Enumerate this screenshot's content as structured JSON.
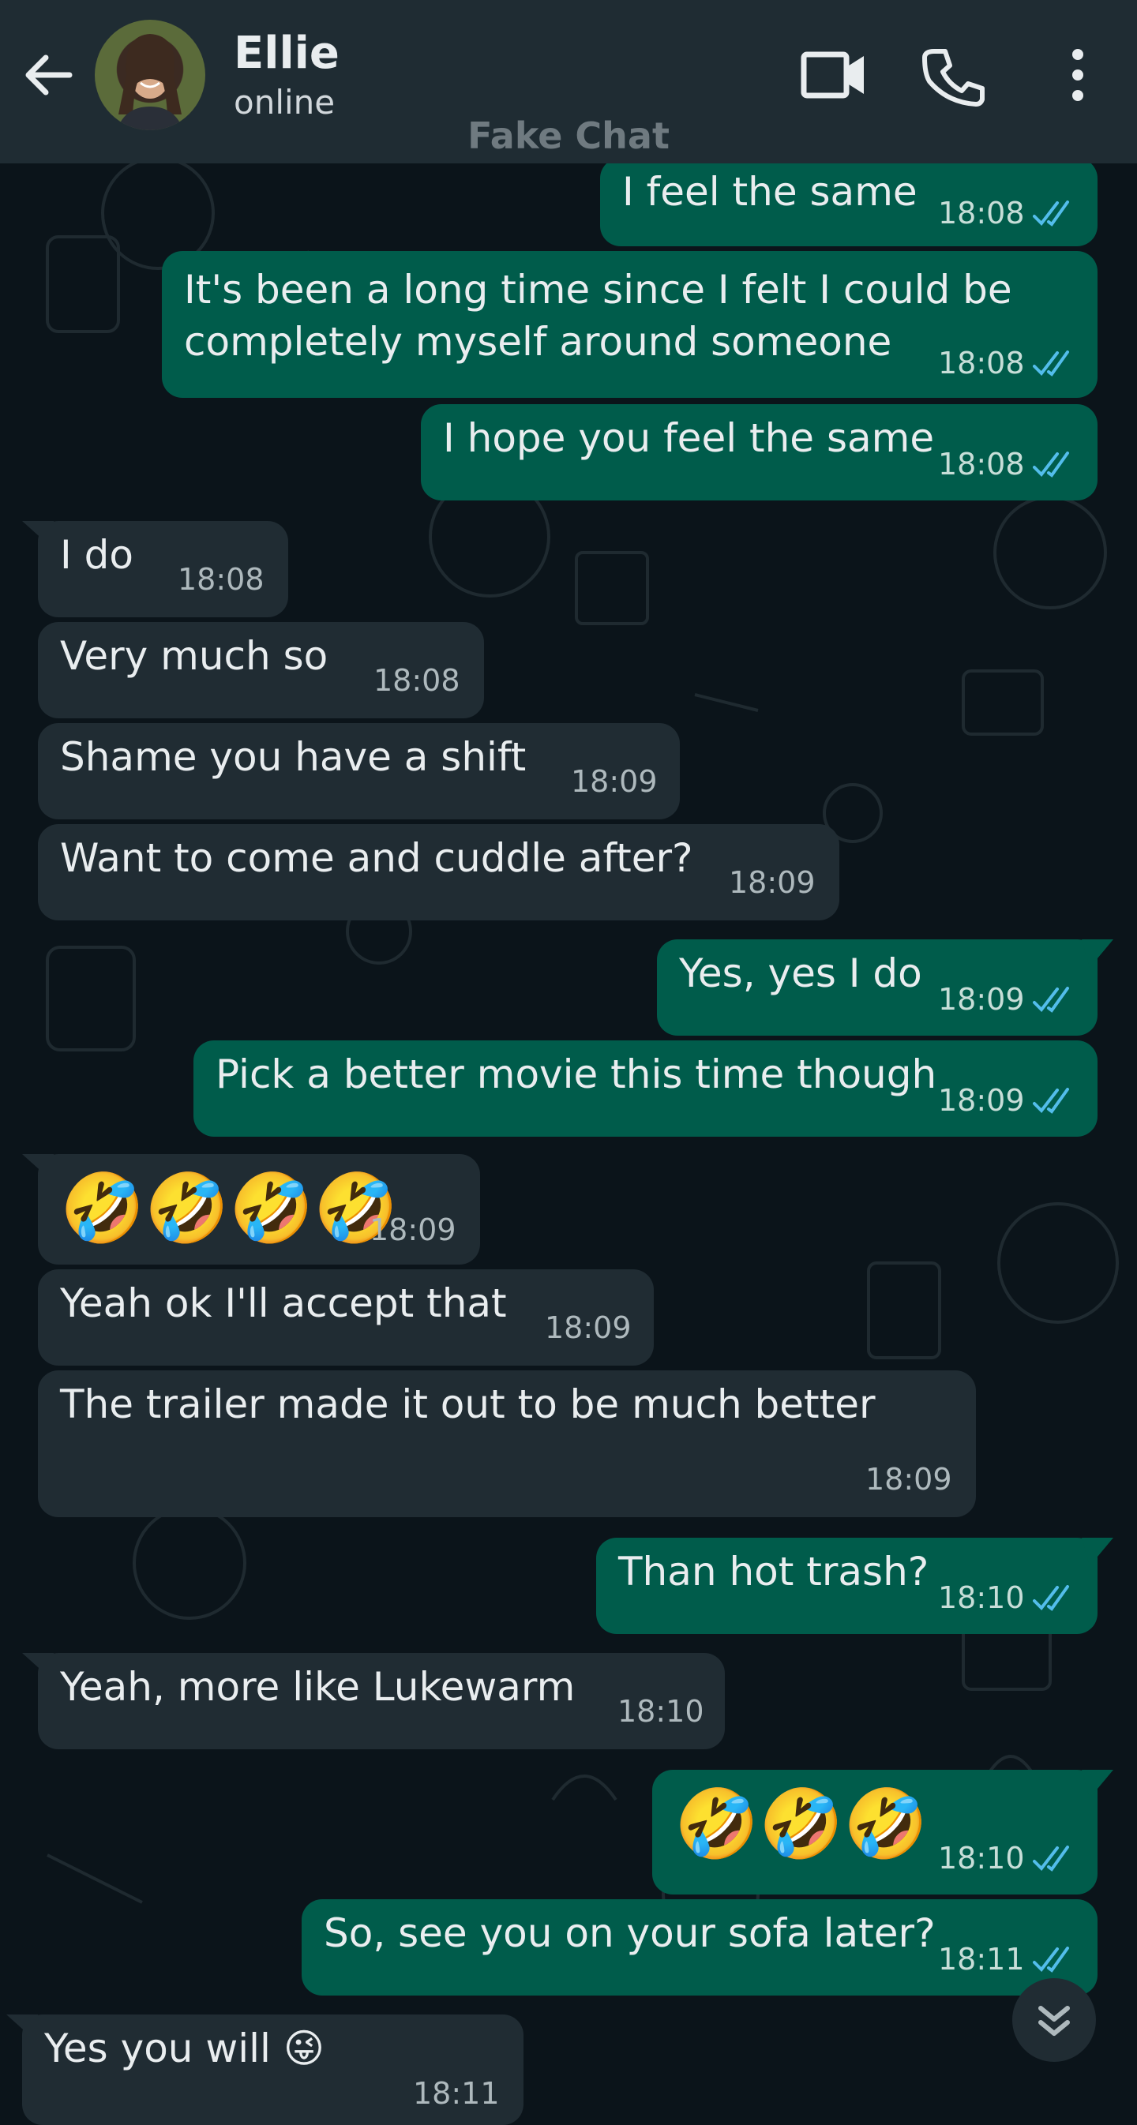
{
  "header": {
    "contact_name": "Ellie",
    "status": "online",
    "watermark": "Fake Chat"
  },
  "colors": {
    "header_bg": "#1f2c33",
    "chat_bg": "#0b141a",
    "incoming_bubble": "#202c33",
    "outgoing_bubble": "#005c4b",
    "read_ticks": "#53bdeb"
  },
  "icons": [
    "back-arrow-icon",
    "video-call-icon",
    "phone-call-icon",
    "more-options-icon",
    "double-check-icon",
    "scroll-down-icon"
  ],
  "messages": [
    {
      "dir": "out",
      "text": "I feel the same",
      "time": "18:08",
      "read": true
    },
    {
      "dir": "out",
      "text": "It's been a long time since I felt I could be completely myself around someone",
      "time": "18:08",
      "read": true
    },
    {
      "dir": "out",
      "text": "I hope you feel the same",
      "time": "18:08",
      "read": true
    },
    {
      "dir": "in",
      "text": "I do",
      "time": "18:08"
    },
    {
      "dir": "in",
      "text": "Very much so",
      "time": "18:08"
    },
    {
      "dir": "in",
      "text": "Shame you have a shift",
      "time": "18:09"
    },
    {
      "dir": "in",
      "text": "Want to come and cuddle after?",
      "time": "18:09"
    },
    {
      "dir": "out",
      "text": "Yes, yes I do",
      "time": "18:09",
      "read": true
    },
    {
      "dir": "out",
      "text": "Pick a better movie this time though",
      "time": "18:09",
      "read": true
    },
    {
      "dir": "in",
      "text": "🤣🤣🤣🤣",
      "time": "18:09"
    },
    {
      "dir": "in",
      "text": "Yeah ok I'll accept that",
      "time": "18:09"
    },
    {
      "dir": "in",
      "text": "The trailer made it out to be much better",
      "time": "18:09"
    },
    {
      "dir": "out",
      "text": "Than hot trash?",
      "time": "18:10",
      "read": true
    },
    {
      "dir": "in",
      "text": "Yeah, more like Lukewarm",
      "time": "18:10"
    },
    {
      "dir": "out",
      "text": "🤣🤣🤣",
      "time": "18:10",
      "read": true
    },
    {
      "dir": "out",
      "text": "So, see you on your sofa later?",
      "time": "18:11",
      "read": true
    },
    {
      "dir": "in",
      "text": "Yes you will 😜",
      "time": "18:11"
    }
  ]
}
